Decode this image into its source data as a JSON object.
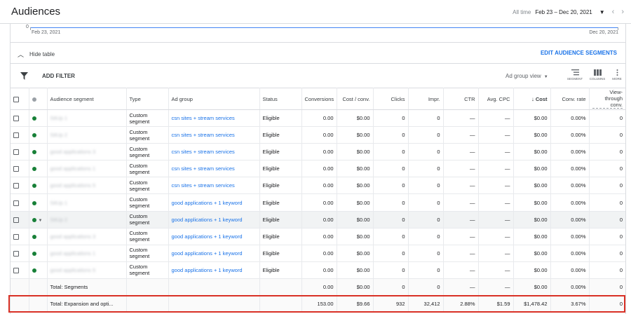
{
  "header": {
    "title": "Audiences",
    "range_label": "All time",
    "range_value": "Feb 23 – Dec 20, 2021"
  },
  "spark": {
    "zero_label": "0",
    "start_date": "Feb 23, 2021",
    "end_date": "Dec 20, 2021"
  },
  "controls": {
    "hide_table": "Hide table",
    "edit_segments": "EDIT AUDIENCE SEGMENTS",
    "add_filter": "ADD FILTER",
    "view_selector": "Ad group view",
    "tool_segment": "SEGMENT",
    "tool_columns": "COLUMNS",
    "tool_more": "MORE"
  },
  "table": {
    "headers": {
      "segment": "Audience segment",
      "type": "Type",
      "adgroup": "Ad group",
      "status": "Status",
      "conversions": "Conversions",
      "cost_conv": "Cost / conv.",
      "clicks": "Clicks",
      "impr": "Impr.",
      "ctr": "CTR",
      "avg_cpc": "Avg. CPC",
      "cost": "Cost",
      "conv_rate": "Conv. rate",
      "vtc": "View-through conv."
    },
    "rows": [
      {
        "segment": "SitUp 1",
        "type": "Custom segment",
        "adgroup": "csn sites + stream services",
        "status": "Eligible",
        "conversions": "0.00",
        "cost_conv": "$0.00",
        "clicks": "0",
        "impr": "0",
        "ctr": "—",
        "avg_cpc": "—",
        "cost": "$0.00",
        "conv_rate": "0.00%",
        "vtc": "0"
      },
      {
        "segment": "SitUp 2",
        "type": "Custom segment",
        "adgroup": "csn sites + stream services",
        "status": "Eligible",
        "conversions": "0.00",
        "cost_conv": "$0.00",
        "clicks": "0",
        "impr": "0",
        "ctr": "—",
        "avg_cpc": "—",
        "cost": "$0.00",
        "conv_rate": "0.00%",
        "vtc": "0"
      },
      {
        "segment": "good applications 3",
        "type": "Custom segment",
        "adgroup": "csn sites + stream services",
        "status": "Eligible",
        "conversions": "0.00",
        "cost_conv": "$0.00",
        "clicks": "0",
        "impr": "0",
        "ctr": "—",
        "avg_cpc": "—",
        "cost": "$0.00",
        "conv_rate": "0.00%",
        "vtc": "0"
      },
      {
        "segment": "good applications 1",
        "type": "Custom segment",
        "adgroup": "csn sites + stream services",
        "status": "Eligible",
        "conversions": "0.00",
        "cost_conv": "$0.00",
        "clicks": "0",
        "impr": "0",
        "ctr": "—",
        "avg_cpc": "—",
        "cost": "$0.00",
        "conv_rate": "0.00%",
        "vtc": "0"
      },
      {
        "segment": "good applications 5",
        "type": "Custom segment",
        "adgroup": "csn sites + stream services",
        "status": "Eligible",
        "conversions": "0.00",
        "cost_conv": "$0.00",
        "clicks": "0",
        "impr": "0",
        "ctr": "—",
        "avg_cpc": "—",
        "cost": "$0.00",
        "conv_rate": "0.00%",
        "vtc": "0"
      },
      {
        "segment": "SitUp 1",
        "type": "Custom segment",
        "adgroup": "good applications + 1 keyword",
        "status": "Eligible",
        "conversions": "0.00",
        "cost_conv": "$0.00",
        "clicks": "0",
        "impr": "0",
        "ctr": "—",
        "avg_cpc": "—",
        "cost": "$0.00",
        "conv_rate": "0.00%",
        "vtc": "0"
      },
      {
        "segment": "SitUp 2",
        "type": "Custom segment",
        "adgroup": "good applications + 1 keyword",
        "status": "Eligible",
        "conversions": "0.00",
        "cost_conv": "$0.00",
        "clicks": "0",
        "impr": "0",
        "ctr": "—",
        "avg_cpc": "—",
        "cost": "$0.00",
        "conv_rate": "0.00%",
        "vtc": "0"
      },
      {
        "segment": "good applications 3",
        "type": "Custom segment",
        "adgroup": "good applications + 1 keyword",
        "status": "Eligible",
        "conversions": "0.00",
        "cost_conv": "$0.00",
        "clicks": "0",
        "impr": "0",
        "ctr": "—",
        "avg_cpc": "—",
        "cost": "$0.00",
        "conv_rate": "0.00%",
        "vtc": "0"
      },
      {
        "segment": "good applications 1",
        "type": "Custom segment",
        "adgroup": "good applications + 1 keyword",
        "status": "Eligible",
        "conversions": "0.00",
        "cost_conv": "$0.00",
        "clicks": "0",
        "impr": "0",
        "ctr": "—",
        "avg_cpc": "—",
        "cost": "$0.00",
        "conv_rate": "0.00%",
        "vtc": "0"
      },
      {
        "segment": "good applications 5",
        "type": "Custom segment",
        "adgroup": "good applications + 1 keyword",
        "status": "Eligible",
        "conversions": "0.00",
        "cost_conv": "$0.00",
        "clicks": "0",
        "impr": "0",
        "ctr": "—",
        "avg_cpc": "—",
        "cost": "$0.00",
        "conv_rate": "0.00%",
        "vtc": "0"
      }
    ],
    "total_segments": {
      "label": "Total: Segments",
      "conversions": "0.00",
      "cost_conv": "$0.00",
      "clicks": "0",
      "impr": "0",
      "ctr": "—",
      "avg_cpc": "—",
      "cost": "$0.00",
      "conv_rate": "0.00%",
      "vtc": "0"
    },
    "total_expansion": {
      "label": "Total: Expansion and opti...",
      "conversions": "153.00",
      "cost_conv": "$9.66",
      "clicks": "932",
      "impr": "32,412",
      "ctr": "2.88%",
      "avg_cpc": "$1.59",
      "cost": "$1,478.42",
      "conv_rate": "3.67%",
      "vtc": "0"
    }
  },
  "colors": {
    "accent": "#1a73e8",
    "status_green": "#188038",
    "highlight_outline": "#d93025"
  }
}
